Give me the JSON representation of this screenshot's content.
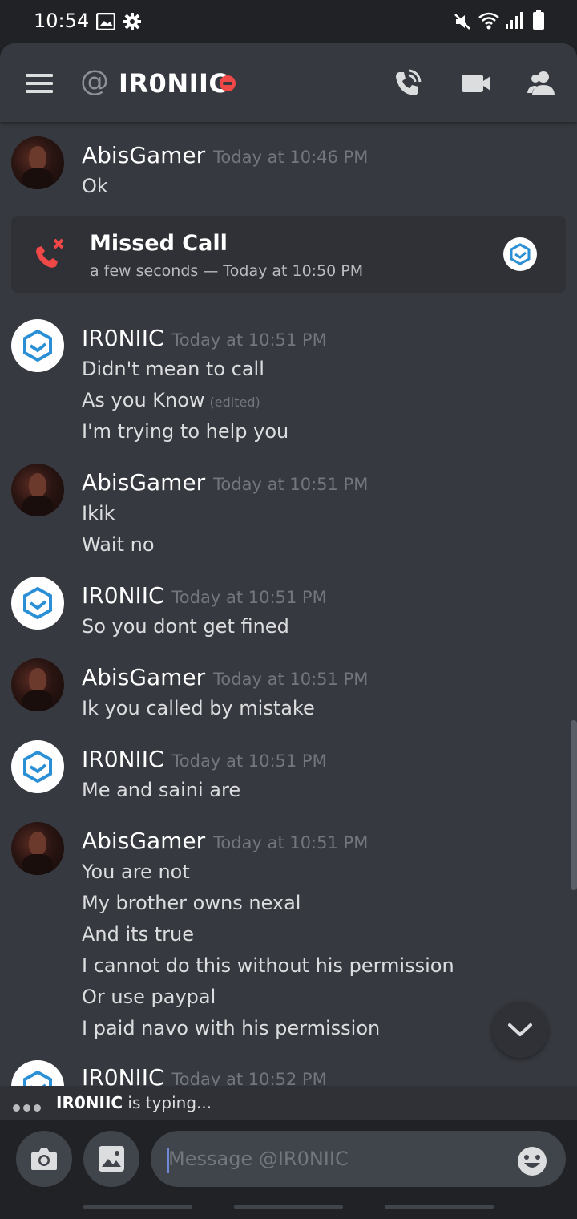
{
  "status_bar": {
    "time": "10:54"
  },
  "header": {
    "at": "@",
    "channel": "IR0NIIC",
    "status": "do-not-disturb",
    "icons": [
      "menu-icon",
      "call-icon",
      "video-icon",
      "members-icon"
    ]
  },
  "messages": [
    {
      "author": "AbisGamer",
      "time": "Today at 10:46 PM",
      "lines": [
        "Ok"
      ]
    },
    {
      "author": "IR0NIIC",
      "time": "Today at 10:51 PM",
      "lines": [
        "Didn't mean to call",
        "As you Know",
        "I'm trying to help you"
      ],
      "edited": "(edited)"
    },
    {
      "author": "AbisGamer",
      "time": "Today at 10:51 PM",
      "lines": [
        "Ikik",
        "Wait no"
      ]
    },
    {
      "author": "IR0NIIC",
      "time": "Today at 10:51 PM",
      "lines": [
        "So you dont get fined"
      ]
    },
    {
      "author": "AbisGamer",
      "time": "Today at 10:51 PM",
      "lines": [
        "Ik you called by mistake"
      ]
    },
    {
      "author": "IR0NIIC",
      "time": "Today at 10:51 PM",
      "lines": [
        "Me and saini are"
      ]
    },
    {
      "author": "AbisGamer",
      "time": "Today at 10:51 PM",
      "lines": [
        "You are not",
        "My brother owns nexal",
        "And its true",
        "I cannot do this without his permission",
        "Or use paypal",
        "I paid navo with his permission"
      ]
    },
    {
      "author": "IR0NIIC",
      "time": "Today at 10:52 PM",
      "lines": []
    }
  ],
  "missed_call": {
    "title": "Missed Call",
    "subtitle": "a few seconds — Today at 10:50 PM"
  },
  "typing": {
    "user": "IR0NIIC",
    "suffix": " is typing..."
  },
  "composer": {
    "placeholder": "Message @IR0NIIC"
  },
  "colors": {
    "background": "#36393f",
    "dnd": "#f04747",
    "blurple": "#7289da",
    "brand_blue": "#2b8fd6"
  }
}
